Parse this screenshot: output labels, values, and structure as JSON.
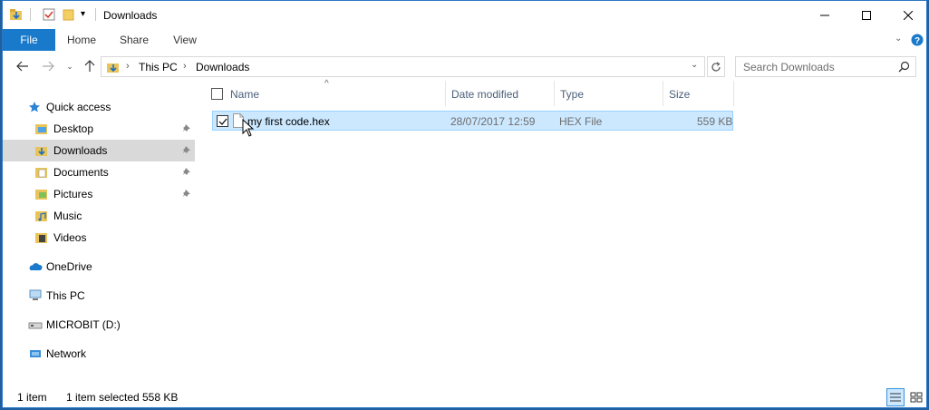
{
  "window": {
    "title": "Downloads"
  },
  "ribbon": {
    "tabs": [
      "File",
      "Home",
      "Share",
      "View"
    ]
  },
  "address": {
    "crumbs": [
      "This PC",
      "Downloads"
    ]
  },
  "search": {
    "placeholder": "Search Downloads"
  },
  "nav": {
    "quick_access": "Quick access",
    "items": [
      {
        "label": "Desktop",
        "pinned": true
      },
      {
        "label": "Downloads",
        "pinned": true,
        "selected": true
      },
      {
        "label": "Documents",
        "pinned": true
      },
      {
        "label": "Pictures",
        "pinned": true
      },
      {
        "label": "Music",
        "pinned": false
      },
      {
        "label": "Videos",
        "pinned": false
      }
    ],
    "onedrive": "OneDrive",
    "thispc": "This PC",
    "microbit": "MICROBIT (D:)",
    "network": "Network"
  },
  "columns": {
    "name": "Name",
    "date": "Date modified",
    "type": "Type",
    "size": "Size"
  },
  "files": [
    {
      "name": "my first code.hex",
      "date": "28/07/2017 12:59",
      "type": "HEX File",
      "size": "559 KB"
    }
  ],
  "status": {
    "count": "1 item",
    "selected": "1 item selected",
    "selected_size": "558 KB"
  },
  "colors": {
    "accent": "#1979ca",
    "selection": "#cce8ff"
  }
}
